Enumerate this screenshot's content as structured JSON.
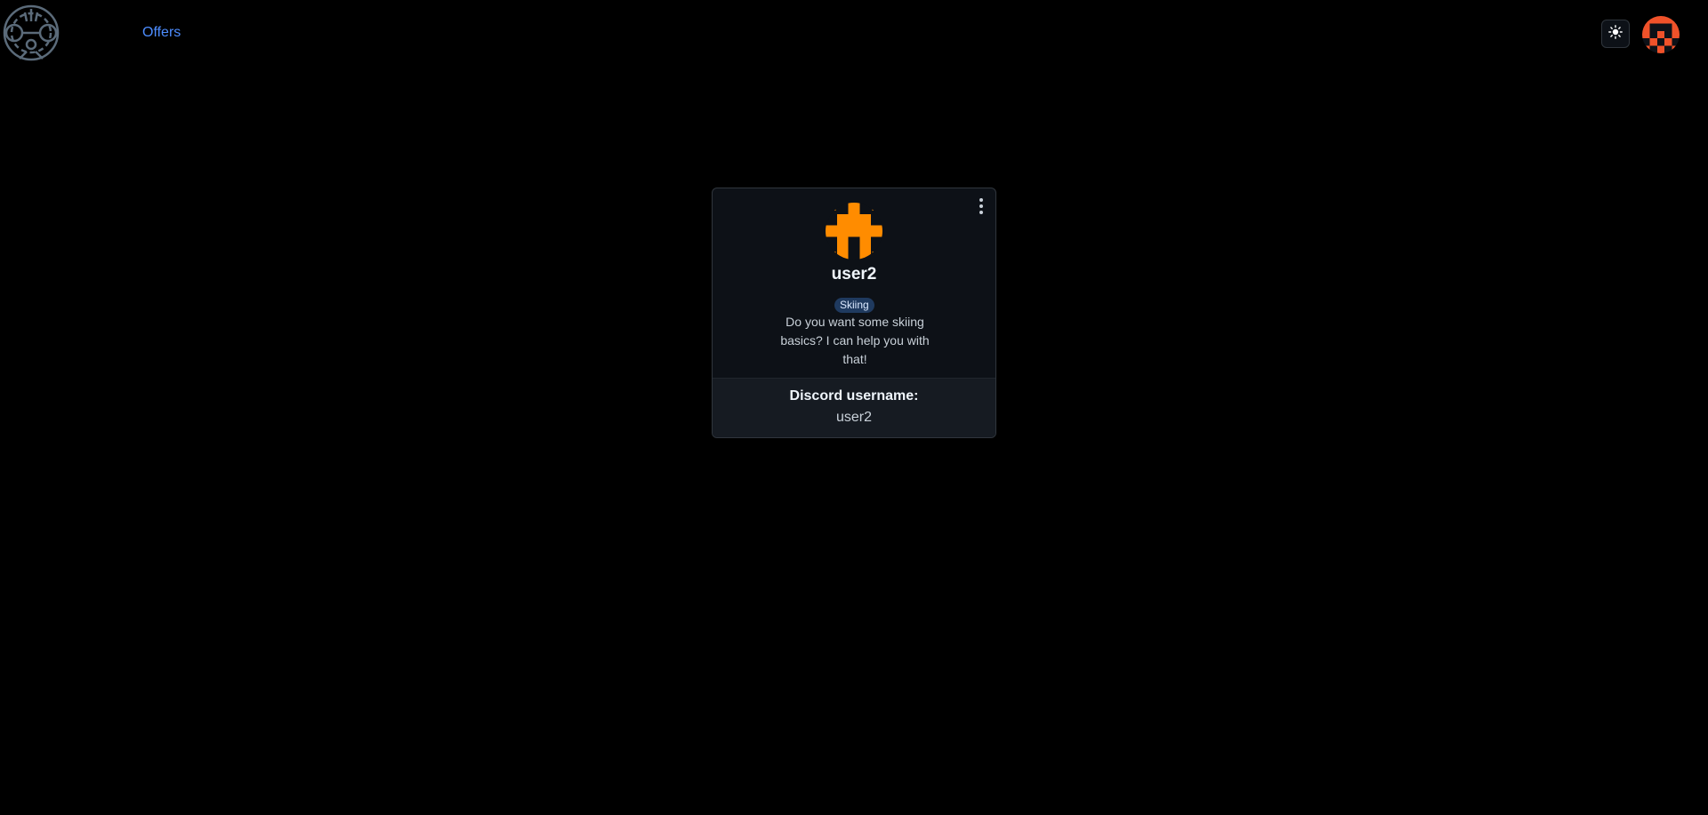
{
  "navbar": {
    "logo_icon": "gear-robot-logo",
    "offers_label": "Offers",
    "theme_icon": "sun-icon",
    "avatar_icon": "identicon-avatar",
    "avatar_color": "#f0522a"
  },
  "profile_card": {
    "menu_icon": "kebab-menu-icon",
    "avatar_icon": "identicon-avatar",
    "avatar_color": "#ff8c00",
    "name": "user2",
    "badge": "Skiing",
    "description": "Do you want some skiing basics? I can help you with that!",
    "footer": {
      "label": "Discord username:",
      "value": "user2"
    }
  },
  "colors": {
    "background": "#000000",
    "card_bg": "#0d1117",
    "link": "#4d8dff",
    "badge_bg": "#1f3a5f"
  }
}
